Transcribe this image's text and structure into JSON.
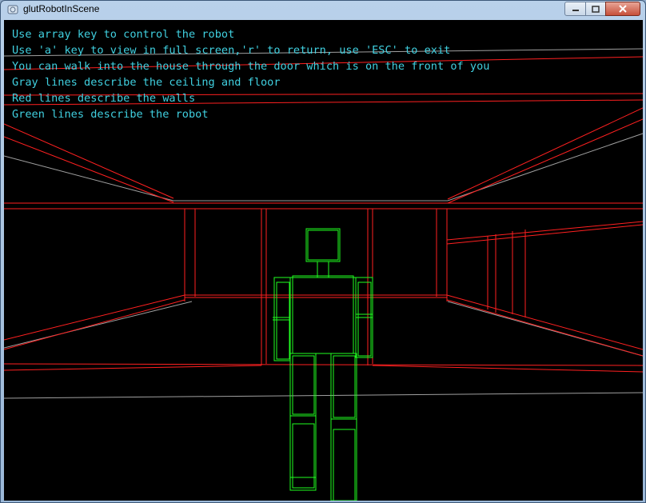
{
  "window": {
    "title": "glutRobotInScene",
    "icon": "glut-app-icon",
    "controls": {
      "minimize_icon": "minimize-icon",
      "maximize_icon": "maximize-icon",
      "close_icon": "close-icon"
    }
  },
  "info_lines": [
    "Use array key to control the robot",
    "Use 'a' key to view in full screen,'r' to return, use 'ESC' to exit",
    "You can walk into the house through the door which is on the front of you",
    "Gray lines describe the ceiling and floor",
    "Red lines describe the walls",
    "Green lines describe the robot"
  ],
  "colors": {
    "background": "#000000",
    "text": "#40d0e0",
    "ceiling_floor": "#a0a0a0",
    "walls": "#ff2020",
    "robot": "#20ff20"
  }
}
